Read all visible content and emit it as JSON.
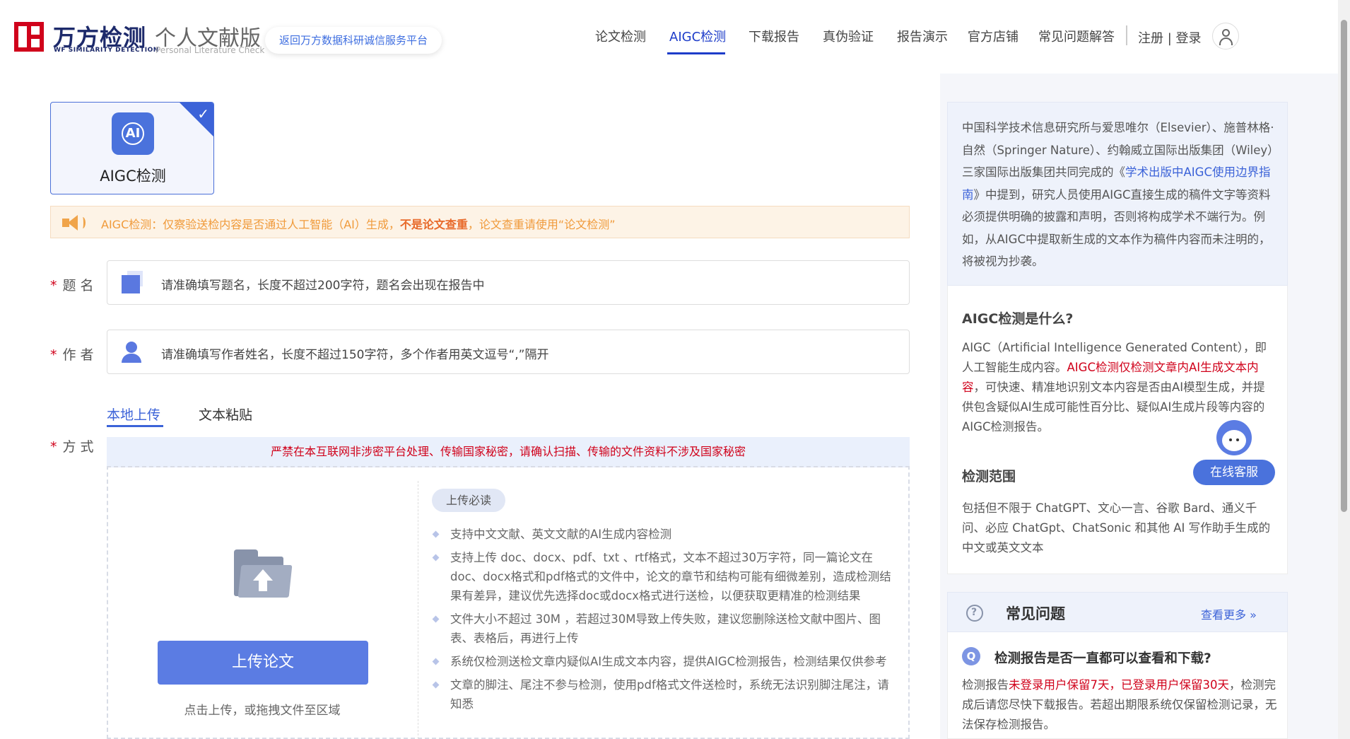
{
  "header": {
    "logo_cn": "万方检测",
    "logo_en": "WF SIMILARITY DETECTION",
    "edition_cn": "个人文献版",
    "edition_en": "Personal Literature Check",
    "return_link": "返回万方数据科研诚信服务平台",
    "nav": [
      "论文检测",
      "AIGC检测",
      "下载报告",
      "真伪验证",
      "报告演示",
      "官方店铺",
      "常见问题解答"
    ],
    "active_nav": "AIGC检测",
    "login": "注册 | 登录"
  },
  "card": {
    "label": "AIGC检测",
    "icon": "AI"
  },
  "notice": {
    "prefix": "AIGC检测：仅察验送检内容是否通过人工智能（AI）生成，",
    "bold": "不是论文查重",
    "suffix": "，论文查重请使用“论文检测”"
  },
  "form": {
    "title_label": "题 名",
    "title_placeholder": "请准确填写题名，长度不超过200字符，题名会出现在报告中",
    "author_label": "作 者",
    "author_placeholder": "请准确填写作者姓名，长度不超过150字符，多个作者用英文逗号“,”隔开",
    "method_label": "方 式",
    "tabs": [
      "本地上传",
      "文本粘贴"
    ],
    "warning": "严禁在本互联网非涉密平台处理、传输国家秘密，请确认扫描、传输的文件资料不涉及国家秘密",
    "upload_button": "上传论文",
    "upload_hint": "点击上传，或拖拽文件至区域",
    "must_read": "上传必读",
    "rules": [
      "支持中文文献、英文文献的AI生成内容检测",
      "支持上传 doc、docx、pdf、txt 、rtf格式，文本不超过30万字符，同一篇论文在doc、docx格式和pdf格式的文件中，论文的章节和结构可能有细微差别，造成检测结果有差异，建议优先选择doc或docx格式进行送检，以便获取更精准的检测结果",
      "文件大小不超过 30M ，若超过30M导致上传失败，建议您删除送检文献中图片、图表、表格后，再进行上传",
      "系统仅检测送检文章内疑似AI生成文本内容，提供AIGC检测报告，检测结果仅供参考",
      "文章的脚注、尾注不参与检测，使用pdf格式文件送检时，系统无法识别脚注尾注，请知悉"
    ]
  },
  "sidebar": {
    "intro_before": "中国科学技术信息研究所与爱思唯尔（Elsevier）、施普林格·自然（Springer Nature）、约翰威立国际出版集团（Wiley）三家国际出版集团共同完成的《",
    "intro_link": "学术出版中AIGC使用边界指南",
    "intro_after": "》中提到，研究人员使用AIGC直接生成的稿件文字等资料必须提供明确的披露和声明，否则将构成学术不端行为。例如，从AIGC中提取新生成的文本作为稿件内容而未注明的，将被视为抄袭。",
    "what_title": "AIGC检测是什么?",
    "what_before": "AIGC（Artificial Intelligence Generated Content），即人工智能生成内容。",
    "what_red": "AIGC检测仅检测文章内AI生成文本内容",
    "what_after": "，可快速、精准地识别文本内容是否由AI模型生成，并提供包含疑似AI生成可能性百分比、疑似AI生成片段等内容的AIGC检测报告。",
    "scope_title": "检测范围",
    "scope_text": "包括但不限于 ChatGPT、文心一言、谷歌 Bard、通义千问、必应 ChatGpt、ChatSonic 和其他 AI 写作助手生成的中文或英文文本",
    "service_button": "在线客服",
    "faq_title": "常见问题",
    "faq_more": "查看更多 »",
    "faq_q": "检测报告是否一直都可以查看和下载?",
    "faq_a_before": "检测报告",
    "faq_a_red": "未登录用户保留7天，已登录用户保留30天",
    "faq_a_after": "，检测完成后请您尽快下载报告。若超出期限系统仅保留检测记录，无法保存检测报告。"
  },
  "colors": {
    "brand_red": "#d0021b",
    "primary_blue": "#3c63d8",
    "notice_orange": "#f09a3a"
  }
}
